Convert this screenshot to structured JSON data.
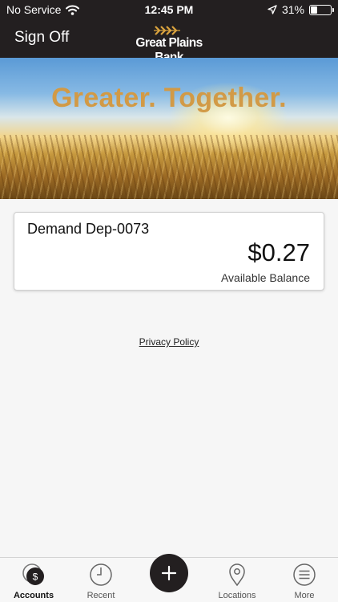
{
  "status_bar": {
    "carrier": "No Service",
    "time": "12:45 PM",
    "battery_percent": "31%",
    "battery_level": 0.31
  },
  "nav": {
    "sign_off_label": "Sign Off",
    "logo_text": "Great Plains Bank"
  },
  "hero": {
    "tagline": "Greater. Together."
  },
  "accounts": [
    {
      "name": "Demand Dep-0073",
      "balance": "$0.27",
      "balance_label": "Available Balance"
    }
  ],
  "footer": {
    "privacy_link": "Privacy Policy"
  },
  "tab_bar": {
    "tabs": [
      {
        "label": "Accounts",
        "icon": "accounts-dollar-icon",
        "active": true
      },
      {
        "label": "Recent",
        "icon": "clock-icon",
        "active": false
      },
      {
        "label": "",
        "icon": "plus-icon",
        "active": false
      },
      {
        "label": "Locations",
        "icon": "map-pin-icon",
        "active": false
      },
      {
        "label": "More",
        "icon": "menu-icon",
        "active": false
      }
    ]
  },
  "colors": {
    "header_bg": "#231f20",
    "tagline": "#d29a46",
    "logo_gold": "#d9a23e"
  }
}
